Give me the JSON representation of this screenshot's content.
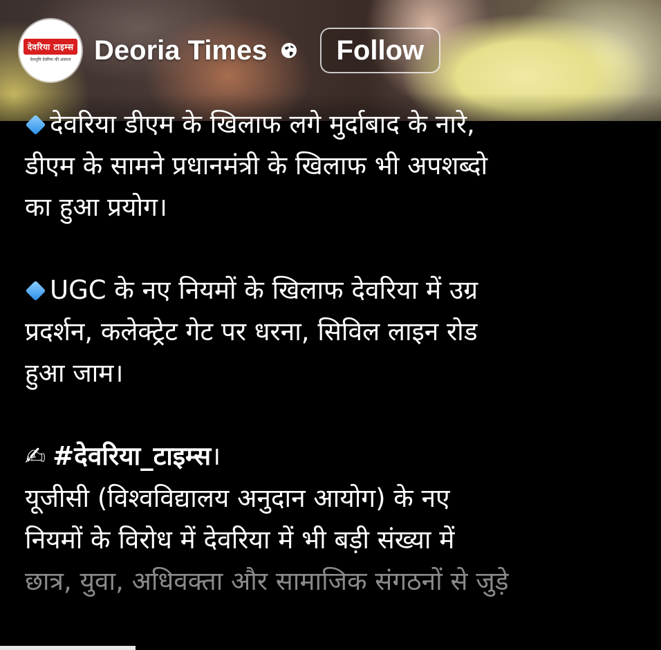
{
  "header": {
    "page_name": "Deoria Times",
    "follow_label": "Follow",
    "avatar_logo": "देवरिया टाइम्स",
    "avatar_tagline": "देवभूमि देवरिया की आवाज"
  },
  "post": {
    "line1": "देवरिया डीएम के खिलाफ लगे मुर्दाबाद के नारे,",
    "line2": "डीएम के सामने प्रधानमंत्री के खिलाफ भी अपशब्दो",
    "line3": "का हुआ प्रयोग।",
    "line4": "UGC के नए नियमों के खिलाफ देवरिया में उग्र",
    "line5": "प्रदर्शन, कलेक्ट्रेट गेट पर धरना, सिविल लाइन रोड",
    "line6": "हुआ जाम।",
    "hashtag": "#देवरिया_टाइम्स",
    "hashtag_suffix": "।",
    "line8": "यूजीसी (विश्वविद्यालय अनुदान आयोग) के नए",
    "line9": "नियमों के विरोध में देवरिया में भी बड़ी संख्या में",
    "line10": "छात्र, युवा, अधिवक्ता और सामाजिक संगठनों से जुड़े"
  },
  "icons": [
    "globe-icon",
    "blue-diamond-icon",
    "writing-hand-icon"
  ]
}
